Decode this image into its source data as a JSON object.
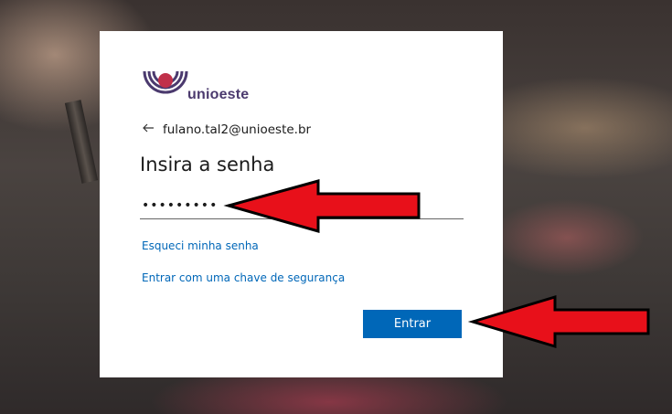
{
  "brand": {
    "name": "unioeste",
    "logo_icon": "unioeste-logo-icon",
    "color": "#4b3a6e",
    "accent": "#c0304a"
  },
  "signin": {
    "back_icon": "back-arrow-icon",
    "identity": "fulano.tal2@unioeste.br",
    "title": "Insira a senha",
    "password_value": "•••••••••",
    "forgot_link": "Esqueci minha senha",
    "security_key_link": "Entrar com uma chave de segurança",
    "submit_label": "Entrar",
    "accent_color": "#0067b8"
  },
  "annotations": {
    "arrow_icon": "red-arrow-icon",
    "arrow_color": "#e8101a"
  }
}
